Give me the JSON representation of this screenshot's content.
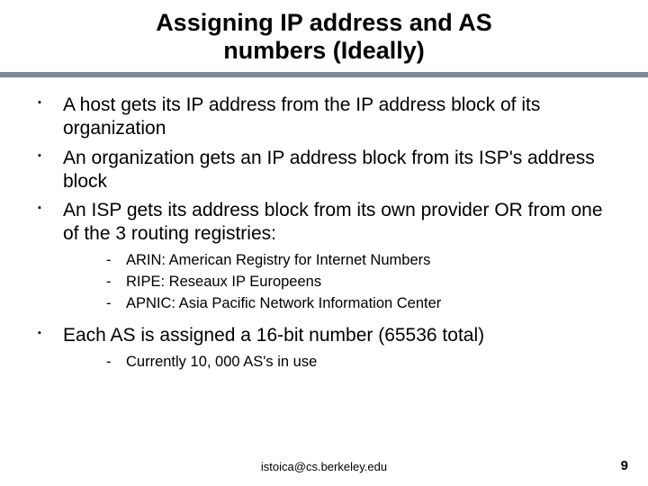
{
  "title_line1": "Assigning IP address and AS",
  "title_line2": "numbers (Ideally)",
  "bullets": {
    "b1": "A host gets its IP address from the IP address block of its organization",
    "b2": "An organization gets an IP address block from its ISP's address block",
    "b3": "An ISP gets its address block from its own provider OR from one of the 3 routing registries:",
    "b3_sub": {
      "s1": "ARIN: American Registry for Internet Numbers",
      "s2": "RIPE: Reseaux IP Europeens",
      "s3": "APNIC: Asia Pacific Network Information Center"
    },
    "b4": "Each AS is assigned a 16-bit number (65536 total)",
    "b4_sub": {
      "s1": "Currently 10, 000 AS's in use"
    }
  },
  "footer": {
    "email": "istoica@cs.berkeley.edu",
    "page": "9"
  }
}
